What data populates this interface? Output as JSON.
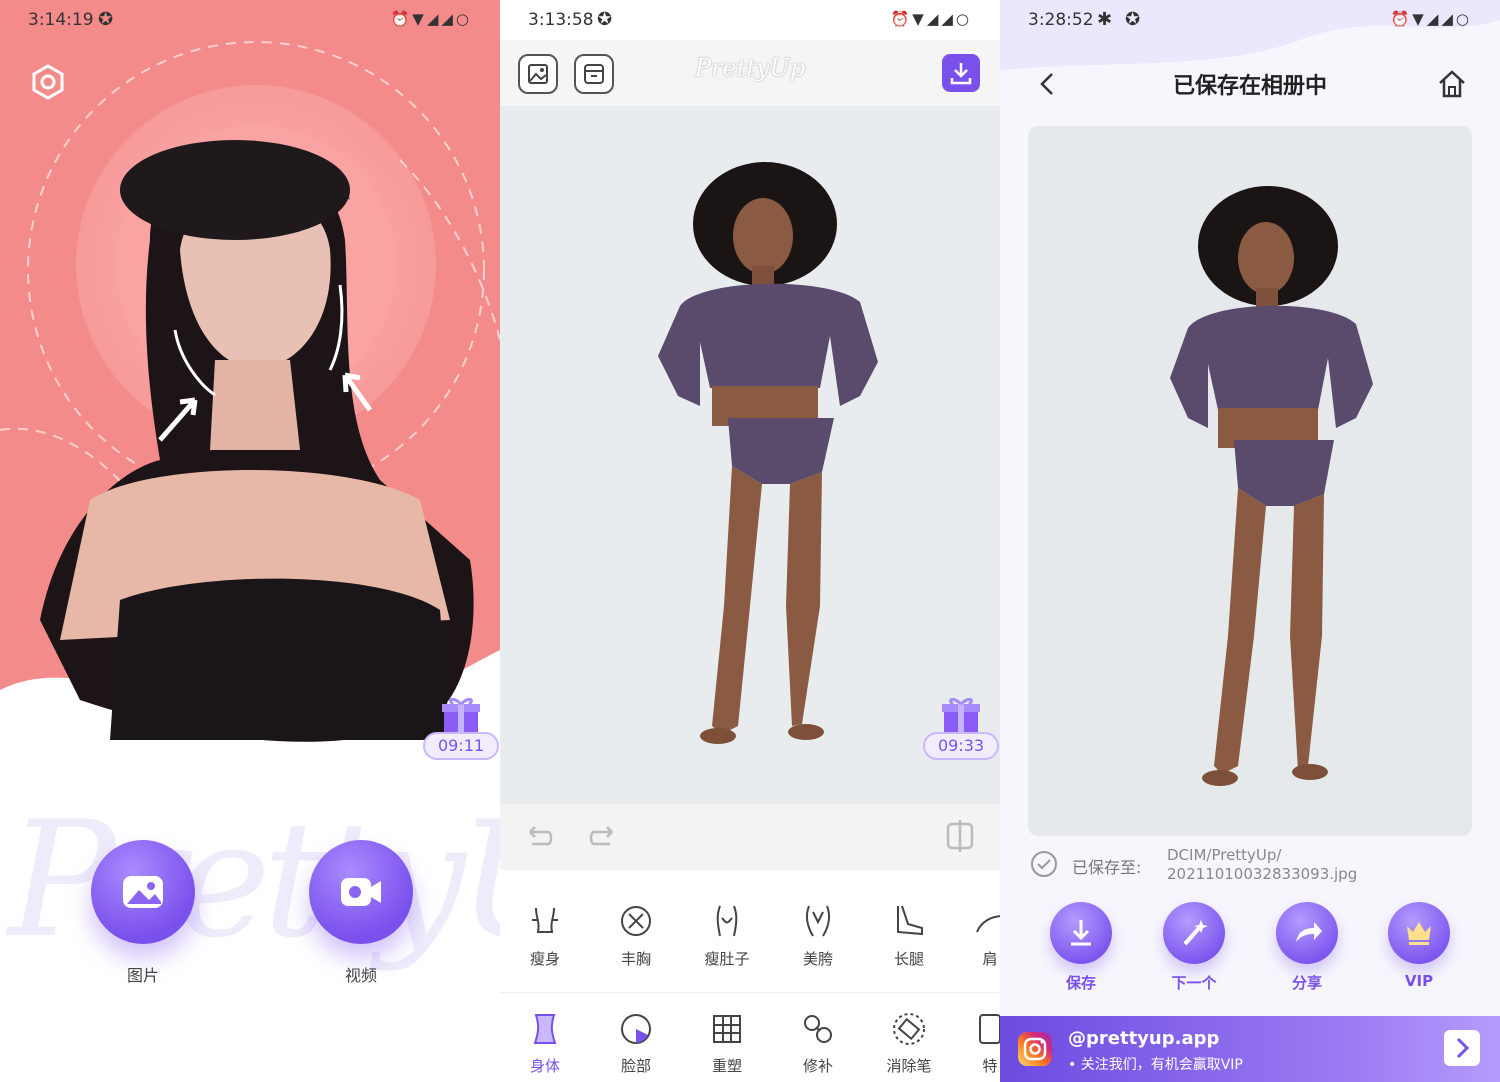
{
  "panel_home": {
    "status": {
      "time": "3:14:19"
    },
    "gift_timer": "09:11",
    "watermark": "PrettyUp",
    "buttons": {
      "photo_label": "图片",
      "video_label": "视频"
    }
  },
  "panel_editor": {
    "status": {
      "time": "3:13:58"
    },
    "logo": "PrettyUp",
    "gift_timer": "09:33",
    "tools": [
      {
        "label": "瘦身",
        "icon": "slim-body-icon"
      },
      {
        "label": "丰胸",
        "icon": "enhance-chest-icon"
      },
      {
        "label": "瘦肚子",
        "icon": "slim-belly-icon"
      },
      {
        "label": "美胯",
        "icon": "hips-icon"
      },
      {
        "label": "长腿",
        "icon": "long-legs-icon"
      },
      {
        "label": "肩",
        "icon": "shoulder-icon"
      }
    ],
    "tabs": [
      {
        "label": "身体",
        "icon": "body-icon",
        "active": true
      },
      {
        "label": "脸部",
        "icon": "face-icon",
        "active": false
      },
      {
        "label": "重塑",
        "icon": "reshape-grid-icon",
        "active": false
      },
      {
        "label": "修补",
        "icon": "patch-icon",
        "active": false
      },
      {
        "label": "消除笔",
        "icon": "eraser-icon",
        "active": false
      },
      {
        "label": "特",
        "icon": "special-icon",
        "active": false
      }
    ]
  },
  "panel_saved": {
    "status": {
      "time": "3:28:52"
    },
    "title": "已保存在相册中",
    "saved_label": "已保存至:",
    "saved_path_line1": "DCIM/PrettyUp/",
    "saved_path_line2": "20211010032833093.jpg",
    "actions": [
      {
        "label": "保存",
        "icon": "download-icon"
      },
      {
        "label": "下一个",
        "icon": "magic-wand-icon"
      },
      {
        "label": "分享",
        "icon": "share-icon"
      },
      {
        "label": "VIP",
        "icon": "crown-icon"
      }
    ],
    "instagram": {
      "handle": "@prettyup.app",
      "subtitle": "• 关注我们，有机会赢取VIP"
    }
  },
  "colors": {
    "accent": "#7a50ec",
    "home_bg": "#f48b8b",
    "gift_purple": "#8b5cf6"
  }
}
